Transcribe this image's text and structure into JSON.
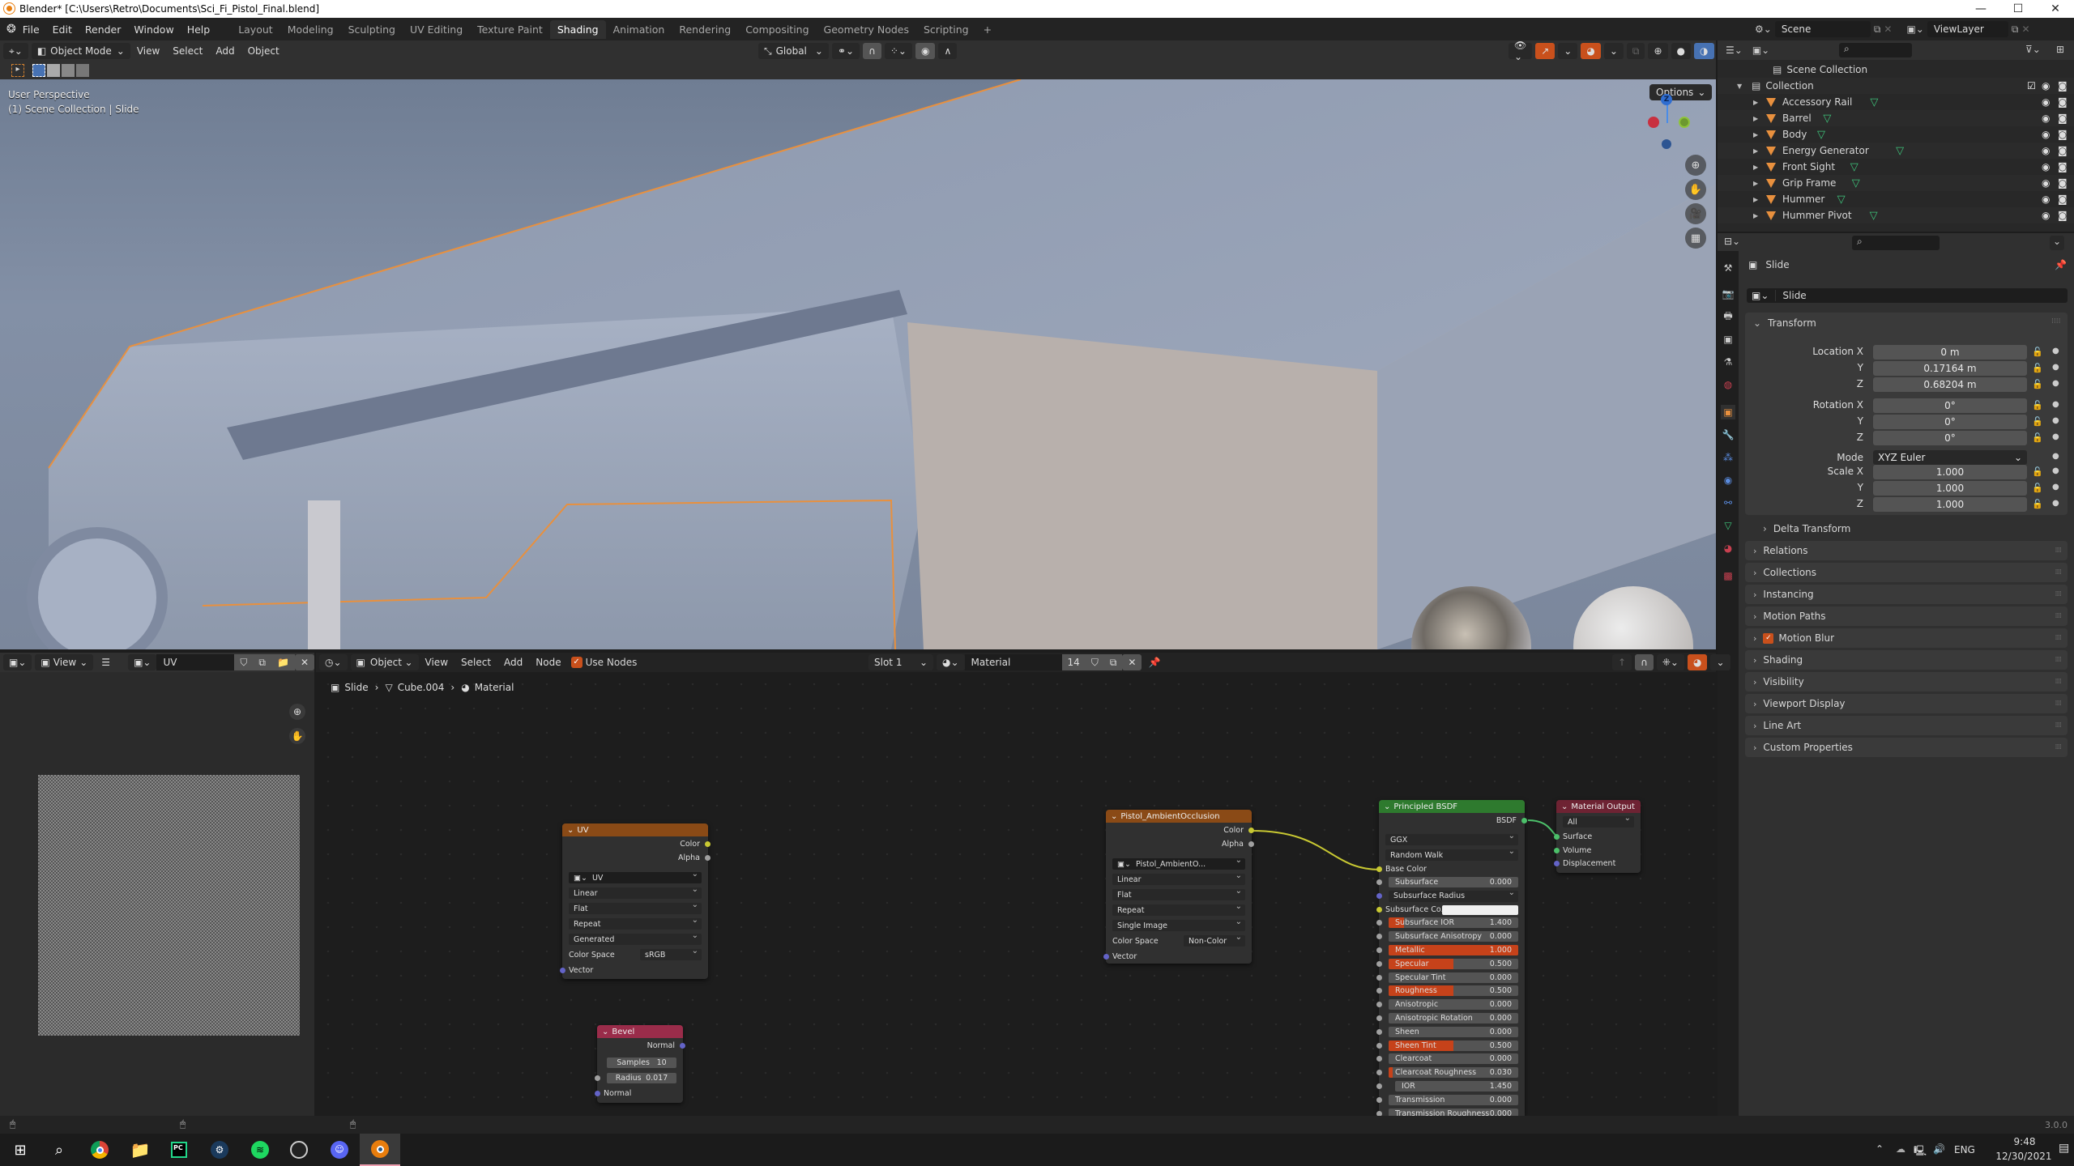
{
  "window": {
    "title": "Blender* [C:\\Users\\Retro\\Documents\\Sci_Fi_Pistol_Final.blend]",
    "controls": [
      "—",
      "☐",
      "✕"
    ]
  },
  "menu": {
    "items": [
      "File",
      "Edit",
      "Render",
      "Window",
      "Help"
    ],
    "workspaces": [
      "Layout",
      "Modeling",
      "Sculpting",
      "UV Editing",
      "Texture Paint",
      "Shading",
      "Animation",
      "Rendering",
      "Compositing",
      "Geometry Nodes",
      "Scripting"
    ],
    "active_workspace": "Shading",
    "add_workspace": "+",
    "scene": "Scene",
    "view_layer": "ViewLayer"
  },
  "viewport": {
    "mode": "Object Mode",
    "menus": [
      "View",
      "Select",
      "Add",
      "Object"
    ],
    "orientation": "Global",
    "options_label": "Options",
    "overlay_line1": "User Perspective",
    "overlay_line2": "(1) Scene Collection | Slide",
    "gizmo_z": "Z",
    "nav_icons": [
      "zoom-icon",
      "pan-hand-icon",
      "camera-icon",
      "grid-icon"
    ]
  },
  "outliner": {
    "root": "Scene Collection",
    "collection": "Collection",
    "objects": [
      "Accessory Rail",
      "Barrel",
      "Body",
      "Energy Generator",
      "Front Sight",
      "Grip Frame",
      "Hummer",
      "Hummer Pivot"
    ]
  },
  "properties": {
    "object_name": "Slide",
    "object_field": "Slide",
    "transform_label": "Transform",
    "location": {
      "label": "Location X",
      "x": "0 m",
      "y": "0.17164 m",
      "z": "0.68204 m"
    },
    "rotation": {
      "label": "Rotation X",
      "x": "0°",
      "y": "0°",
      "z": "0°"
    },
    "mode": {
      "label": "Mode",
      "value": "XYZ Euler"
    },
    "scale": {
      "label": "Scale X",
      "x": "1.000",
      "y": "1.000",
      "z": "1.000"
    },
    "axis_y": "Y",
    "axis_z": "Z",
    "delta_transform": "Delta Transform",
    "panels": [
      "Relations",
      "Collections",
      "Instancing",
      "Motion Paths",
      "Motion Blur",
      "Shading",
      "Visibility",
      "Viewport Display",
      "Line Art",
      "Custom Properties"
    ]
  },
  "image_editor": {
    "view_label": "View",
    "image_name": "UV"
  },
  "node_editor": {
    "object_dropdown": "Object",
    "menus": [
      "View",
      "Select",
      "Add",
      "Node"
    ],
    "use_nodes_label": "Use Nodes",
    "use_nodes_checked": true,
    "slot": "Slot 1",
    "material": "Material",
    "users": "14",
    "breadcrumb": [
      "Slide",
      "Cube.004",
      "Material"
    ],
    "nodes": {
      "uv": {
        "title": "UV",
        "outputs": [
          "Color",
          "Alpha"
        ],
        "image": "UV",
        "interpolation": "Linear",
        "projection": "Flat",
        "extension": "Repeat",
        "source": "Generated",
        "color_space_label": "Color Space",
        "color_space": "sRGB",
        "input": "Vector"
      },
      "bevel": {
        "title": "Bevel",
        "output": "Normal",
        "samples_label": "Samples",
        "samples": "10",
        "radius_label": "Radius",
        "radius": "0.017",
        "input": "Normal"
      },
      "ao": {
        "title": "Pistol_AmbientOcclusion",
        "outputs": [
          "Color",
          "Alpha"
        ],
        "image": "Pistol_AmbientO...",
        "interpolation": "Linear",
        "projection": "Flat",
        "extension": "Repeat",
        "source": "Single Image",
        "color_space_label": "Color Space",
        "color_space": "Non-Color",
        "input": "Vector"
      },
      "bsdf": {
        "title": "Principled BSDF",
        "output": "BSDF",
        "distribution": "GGX",
        "subsurface_method": "Random Walk",
        "base_color": "Base Color",
        "subsurface_radius": "Subsurface Radius",
        "subsurface_color": "Subsurface Co...",
        "sliders": [
          {
            "label": "Subsurface",
            "value": "0.000",
            "fill": 0
          },
          {
            "label": "Subsurface IOR",
            "value": "1.400",
            "fill": 0.12
          },
          {
            "label": "Subsurface Anisotropy",
            "value": "0.000",
            "fill": 0
          },
          {
            "label": "Metallic",
            "value": "1.000",
            "fill": 1
          },
          {
            "label": "Specular",
            "value": "0.500",
            "fill": 0.5
          },
          {
            "label": "Specular Tint",
            "value": "0.000",
            "fill": 0
          },
          {
            "label": "Roughness",
            "value": "0.500",
            "fill": 0.5
          },
          {
            "label": "Anisotropic",
            "value": "0.000",
            "fill": 0
          },
          {
            "label": "Anisotropic Rotation",
            "value": "0.000",
            "fill": 0
          },
          {
            "label": "Sheen",
            "value": "0.000",
            "fill": 0
          },
          {
            "label": "Sheen Tint",
            "value": "0.500",
            "fill": 0.5
          },
          {
            "label": "Clearcoat",
            "value": "0.000",
            "fill": 0
          },
          {
            "label": "Clearcoat Roughness",
            "value": "0.030",
            "fill": 0.03
          },
          {
            "label": "IOR",
            "value": "1.450",
            "fill": 0
          },
          {
            "label": "Transmission",
            "value": "0.000",
            "fill": 0
          },
          {
            "label": "Transmission Roughness",
            "value": "0.000",
            "fill": 0
          }
        ]
      },
      "output": {
        "title": "Material Output",
        "target": "All",
        "inputs": [
          "Surface",
          "Volume",
          "Displacement"
        ]
      }
    }
  },
  "status": {
    "version": "3.0.0"
  },
  "taskbar": {
    "apps": [
      "windows-start",
      "search",
      "chrome",
      "file-explorer",
      "pycharm",
      "steam",
      "spotify",
      "obs",
      "discord",
      "blender"
    ],
    "language": "ENG",
    "time": "9:48",
    "date": "12/30/2021"
  },
  "colors": {
    "accent_blue": "#4772b3",
    "accent_orange": "#c9501c",
    "selection_outline": "#e8903e",
    "node_texture_header": "#8a4a16",
    "node_shader_header": "#2e7a2e",
    "node_output_header": "#6e2333",
    "node_bevel_header": "#9a2c4a"
  }
}
